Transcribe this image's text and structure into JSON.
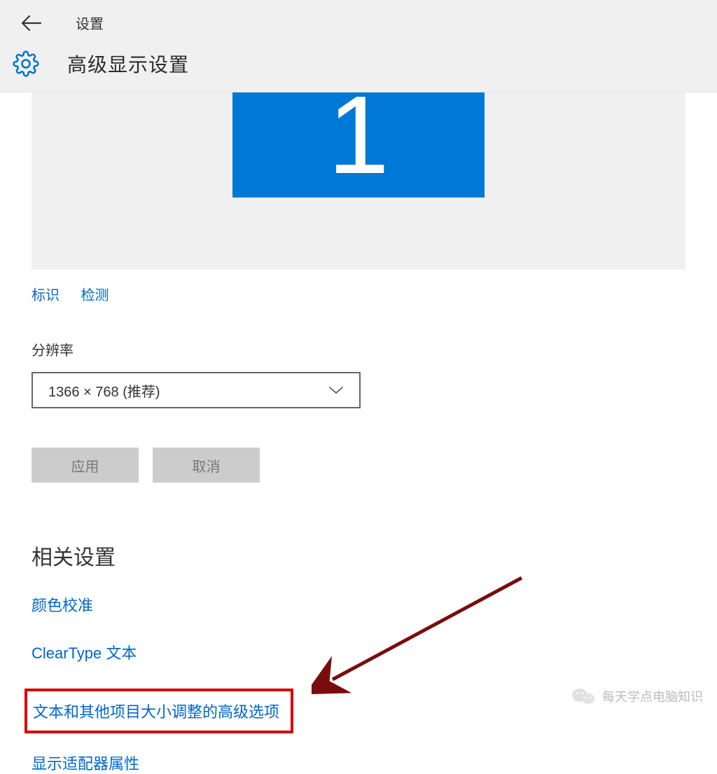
{
  "header": {
    "settings_label": "设置",
    "page_title": "高级显示设置"
  },
  "monitor": {
    "number": "1",
    "identify_link": "标识",
    "detect_link": "检测"
  },
  "resolution": {
    "label": "分辨率",
    "value": "1366 × 768 (推荐)"
  },
  "buttons": {
    "apply": "应用",
    "cancel": "取消"
  },
  "related": {
    "heading": "相关设置",
    "color_calibration": "颜色校准",
    "cleartype": "ClearType 文本",
    "advanced_sizing": "文本和其他项目大小调整的高级选项",
    "adapter_properties": "显示适配器属性"
  },
  "watermark": {
    "text": "每天学点电脑知识"
  },
  "colors": {
    "accent": "#0078d7",
    "link": "#0066cc",
    "highlight_border": "#d60000"
  }
}
